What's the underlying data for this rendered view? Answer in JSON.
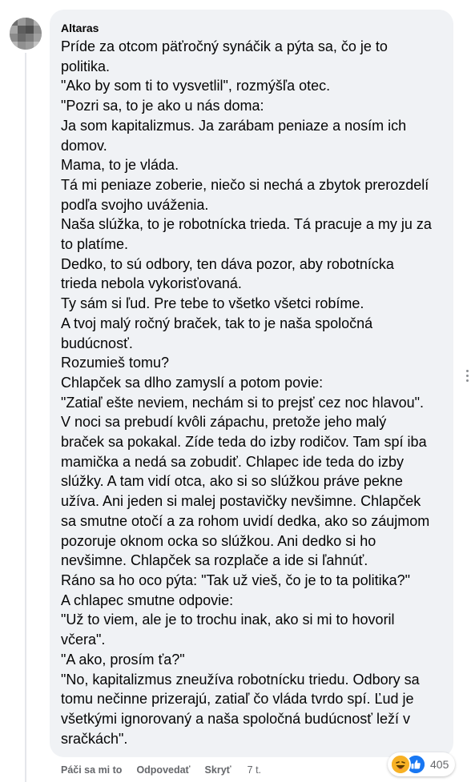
{
  "comment": {
    "author": "Altaras",
    "lines": [
      "Príde za otcom päťročný synáčik a pýta sa, čo je to",
      "politika.",
      "\"Ako by som ti to vysvetlil\", rozmýšľa otec.",
      "\"Pozri sa, to je ako u nás doma:",
      "Ja som kapitalizmus. Ja zarábam peniaze a nosím ich",
      "domov.",
      "Mama, to je vláda.",
      "Tá mi peniaze zoberie, niečo si nechá a zbytok prerozdelí",
      "podľa svojho uváženia.",
      "Naša slúžka, to je robotnícka trieda. Tá pracuje a my ju za",
      "to platíme.",
      "Dedko, to sú odbory, ten dáva pozor, aby robotnícka",
      "trieda nebola vykorisťovaná.",
      "Ty sám si ľud. Pre tebe to všetko všetci robíme.",
      "A tvoj malý ročný braček, tak to je naša spoločná",
      "budúcnosť.",
      "Rozumieš tomu?",
      "Chlapček sa dlho zamyslí a potom povie:",
      "\"Zatiaľ ešte neviem, nechám si to prejsť cez noc hlavou\".",
      "V noci sa prebudí kvôli zápachu, pretože jeho malý",
      "braček sa pokakal. Zíde teda do izby rodičov. Tam spí iba",
      "mamička a nedá sa zobudiť. Chlapec ide teda do izby",
      "slúžky. A tam vidí otca, ako si so slúžkou práve pekne",
      "užíva. Ani jeden si malej postavičky nevšimne. Chlapček",
      "sa smutne otočí a za rohom uvidí dedka, ako so záujmom",
      "pozoruje oknom ocka so slúžkou. Ani dedko si ho",
      "nevšimne. Chlapček sa rozplače a ide si ľahnúť.",
      "Ráno sa ho oco pýta: \"Tak už vieš, čo je to ta politika?\"",
      "A chlapec smutne odpovie:",
      "\"Už to viem, ale je to trochu inak, ako si mi to hovoril",
      "včera\".",
      "\"A ako, prosím ťa?\"",
      "\"No, kapitalizmus zneužíva robotnícku triedu. Odbory sa",
      "tomu nečinne prizerajú, zatiaľ čo vláda tvrdo spí. Ľud je",
      "všetkými ignorovaný a naša spoločná budúcnosť leží v",
      "sračkách\"."
    ]
  },
  "reactions": {
    "icons": [
      "haha-icon",
      "like-icon"
    ],
    "count": "405"
  },
  "actions": {
    "like_label": "Páči sa mi to",
    "reply_label": "Odpovedať",
    "hide_label": "Skryť",
    "timestamp": "7 t."
  },
  "colors": {
    "bubble_bg": "#f0f2f5",
    "text": "#050505",
    "secondary_text": "#65676b",
    "like_blue": "#1877f2",
    "haha_yellow": "#f7b125"
  }
}
